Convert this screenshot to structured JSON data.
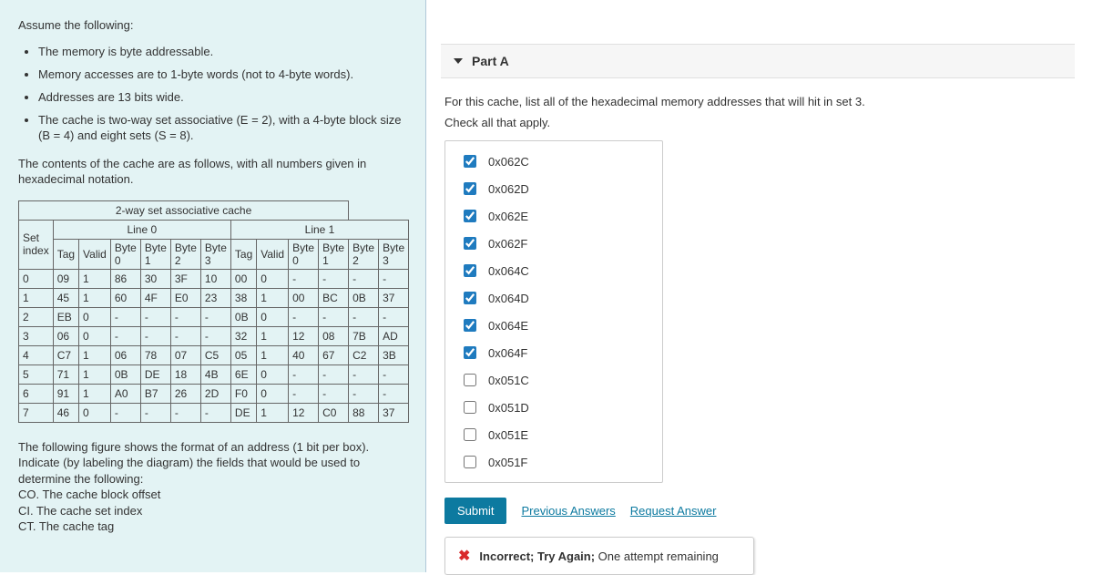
{
  "left": {
    "assume": "Assume the following:",
    "bullets": [
      "The memory is byte addressable.",
      "Memory accesses are to 1-byte words (not to 4-byte words).",
      "Addresses are 13 bits wide.",
      "The cache is two-way set associative (E = 2), with a 4-byte block size (B = 4) and eight sets (S = 8)."
    ],
    "contents_note": "The contents of the cache are as follows, with all numbers given in hexadecimal notation.",
    "table_title": "2-way set associative cache",
    "line0": "Line 0",
    "line1": "Line 1",
    "headers": {
      "set": "Set index",
      "tag": "Tag",
      "valid": "Valid",
      "b0": "Byte 0",
      "b1": "Byte 1",
      "b2": "Byte 2",
      "b3": "Byte 3"
    },
    "rows": [
      {
        "s": "0",
        "t0": "09",
        "v0": "1",
        "b00": "86",
        "b01": "30",
        "b02": "3F",
        "b03": "10",
        "t1": "00",
        "v1": "0",
        "b10": "-",
        "b11": "-",
        "b12": "-",
        "b13": "-"
      },
      {
        "s": "1",
        "t0": "45",
        "v0": "1",
        "b00": "60",
        "b01": "4F",
        "b02": "E0",
        "b03": "23",
        "t1": "38",
        "v1": "1",
        "b10": "00",
        "b11": "BC",
        "b12": "0B",
        "b13": "37"
      },
      {
        "s": "2",
        "t0": "EB",
        "v0": "0",
        "b00": "-",
        "b01": "-",
        "b02": "-",
        "b03": "-",
        "t1": "0B",
        "v1": "0",
        "b10": "-",
        "b11": "-",
        "b12": "-",
        "b13": "-"
      },
      {
        "s": "3",
        "t0": "06",
        "v0": "0",
        "b00": "-",
        "b01": "-",
        "b02": "-",
        "b03": "-",
        "t1": "32",
        "v1": "1",
        "b10": "12",
        "b11": "08",
        "b12": "7B",
        "b13": "AD"
      },
      {
        "s": "4",
        "t0": "C7",
        "v0": "1",
        "b00": "06",
        "b01": "78",
        "b02": "07",
        "b03": "C5",
        "t1": "05",
        "v1": "1",
        "b10": "40",
        "b11": "67",
        "b12": "C2",
        "b13": "3B"
      },
      {
        "s": "5",
        "t0": "71",
        "v0": "1",
        "b00": "0B",
        "b01": "DE",
        "b02": "18",
        "b03": "4B",
        "t1": "6E",
        "v1": "0",
        "b10": "-",
        "b11": "-",
        "b12": "-",
        "b13": "-"
      },
      {
        "s": "6",
        "t0": "91",
        "v0": "1",
        "b00": "A0",
        "b01": "B7",
        "b02": "26",
        "b03": "2D",
        "t1": "F0",
        "v1": "0",
        "b10": "-",
        "b11": "-",
        "b12": "-",
        "b13": "-"
      },
      {
        "s": "7",
        "t0": "46",
        "v0": "0",
        "b00": "-",
        "b01": "-",
        "b02": "-",
        "b03": "-",
        "t1": "DE",
        "v1": "1",
        "b10": "12",
        "b11": "C0",
        "b12": "88",
        "b13": "37"
      }
    ],
    "addr_note": "The following figure shows the format of an address (1 bit per box). Indicate (by labeling the diagram) the fields that would be used to determine the following:",
    "co": "CO. The cache block offset",
    "ci": "CI. The cache set index",
    "ct": "CT. The cache tag"
  },
  "right": {
    "part": "Part A",
    "question": "For this cache, list all of the hexadecimal memory addresses that will hit in set 3.",
    "check": "Check all that apply.",
    "options": [
      {
        "label": "0x062C",
        "checked": true
      },
      {
        "label": "0x062D",
        "checked": true
      },
      {
        "label": "0x062E",
        "checked": true
      },
      {
        "label": "0x062F",
        "checked": true
      },
      {
        "label": "0x064C",
        "checked": true
      },
      {
        "label": "0x064D",
        "checked": true
      },
      {
        "label": "0x064E",
        "checked": true
      },
      {
        "label": "0x064F",
        "checked": true
      },
      {
        "label": "0x051C",
        "checked": false
      },
      {
        "label": "0x051D",
        "checked": false
      },
      {
        "label": "0x051E",
        "checked": false
      },
      {
        "label": "0x051F",
        "checked": false
      }
    ],
    "submit": "Submit",
    "prev": "Previous Answers",
    "req": "Request Answer",
    "feedback_bold": "Incorrect; Try Again;",
    "feedback_rest": " One attempt remaining"
  }
}
